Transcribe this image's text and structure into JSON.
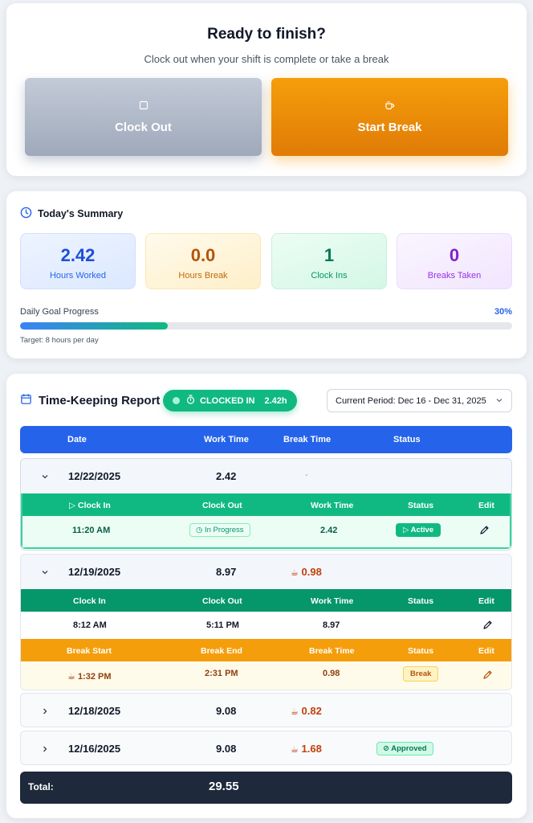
{
  "finish": {
    "title": "Ready to finish?",
    "subtitle": "Clock out when your shift is complete or take a break",
    "clock_out_label": "Clock Out",
    "start_break_label": "Start Break"
  },
  "summary": {
    "title": "Today's Summary",
    "stats": [
      {
        "value": "2.42",
        "label": "Hours Worked"
      },
      {
        "value": "0.0",
        "label": "Hours Break"
      },
      {
        "value": "1",
        "label": "Clock Ins"
      },
      {
        "value": "0",
        "label": "Breaks Taken"
      }
    ],
    "goal_label": "Daily Goal Progress",
    "goal_percent_text": "30%",
    "goal_fraction": 0.3,
    "goal_target": "Target: 8 hours per day"
  },
  "report": {
    "title": "Time-Keeping Report",
    "status_pill": {
      "label": "CLOCKED IN",
      "hours": "2.42h"
    },
    "period": "Current Period: Dec 16 - Dec 31, 2025",
    "columns": [
      "Date",
      "Work Time",
      "Break Time",
      "Status"
    ],
    "entries": [
      {
        "date": "12/22/2025",
        "work": "2.42",
        "break": "-"
      },
      {
        "date": "12/19/2025",
        "work": "8.97",
        "break": "0.98"
      },
      {
        "date": "12/18/2025",
        "work": "9.08",
        "break": "0.82"
      },
      {
        "date": "12/16/2025",
        "work": "9.08",
        "break": "1.68",
        "status": "Approved"
      }
    ],
    "sub_clock_cols": [
      "Clock In",
      "Clock Out",
      "Work Time",
      "Status",
      "Edit"
    ],
    "sub_break_cols": [
      "Break Start",
      "Break End",
      "Break Time",
      "Status",
      "Edit"
    ],
    "entry1_clock": {
      "in": "11:20 AM",
      "out": "In Progress",
      "work": "2.42",
      "status": "Active"
    },
    "entry2_clock": {
      "in": "8:12 AM",
      "out": "5:11 PM",
      "work": "8.97"
    },
    "entry2_break": {
      "start": "1:32 PM",
      "end": "2:31 PM",
      "time": "0.98",
      "status": "Break"
    },
    "total_label": "Total:",
    "total_value": "29.55"
  },
  "colors": {
    "primary": "#2563eb",
    "success": "#10b981",
    "warning": "#f59e0b",
    "dark": "#1e293b"
  }
}
